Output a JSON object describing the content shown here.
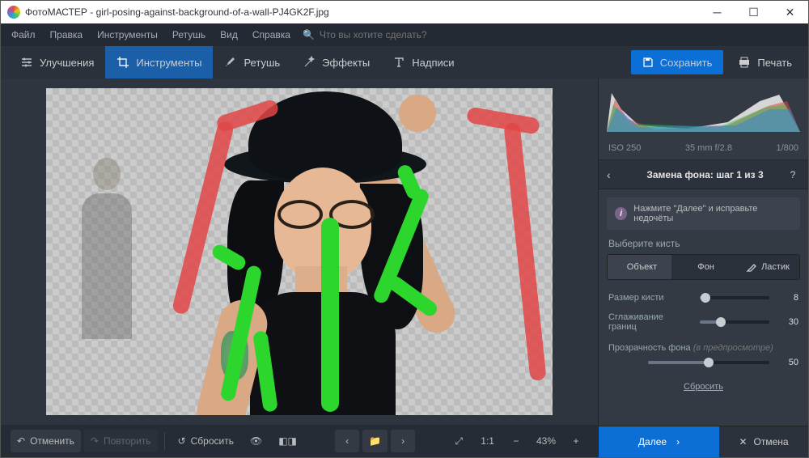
{
  "title": "ФотоМАСТЕР - girl-posing-against-background-of-a-wall-PJ4GK2F.jpg",
  "menu": {
    "file": "Файл",
    "edit": "Правка",
    "tools": "Инструменты",
    "retouch": "Ретушь",
    "view": "Вид",
    "help": "Справка",
    "search_placeholder": "Что вы хотите сделать?"
  },
  "tabs": {
    "enhance": "Улучшения",
    "tools": "Инструменты",
    "retouch": "Ретушь",
    "effects": "Эффекты",
    "text": "Надписи"
  },
  "toolbar": {
    "save": "Сохранить",
    "print": "Печать"
  },
  "bottom": {
    "undo": "Отменить",
    "redo": "Повторить",
    "reset": "Сбросить",
    "zoom_ratio": "1:1",
    "zoom_pct": "43%"
  },
  "exif": {
    "iso": "ISO 250",
    "lens": "35 mm f/2.8",
    "shutter": "1/800"
  },
  "step": {
    "title": "Замена фона: шаг 1 из 3",
    "hint": "Нажмите \"Далее\" и исправьте недочёты"
  },
  "brush": {
    "label": "Выберите кисть",
    "object": "Объект",
    "background": "Фон",
    "eraser": "Ластик"
  },
  "sliders": {
    "size_label": "Размер кисти",
    "size_value": "8",
    "smooth_label": "Сглаживание границ",
    "smooth_value": "30",
    "opacity_label": "Прозрачность фона",
    "opacity_note": "(в предпросмотре)",
    "opacity_value": "50",
    "reset": "Сбросить"
  },
  "actions": {
    "next": "Далее",
    "cancel": "Отмена"
  }
}
